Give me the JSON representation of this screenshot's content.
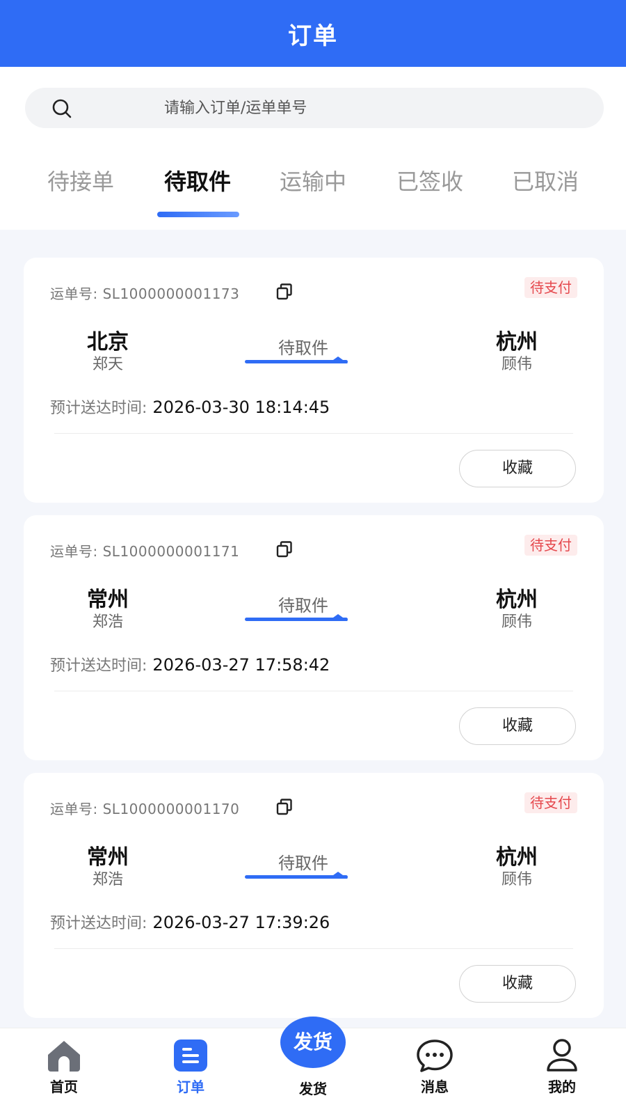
{
  "header": {
    "title": "订单"
  },
  "search": {
    "placeholder": "请输入订单/运单单号"
  },
  "tabs": [
    {
      "label": "待接单",
      "active": false
    },
    {
      "label": "待取件",
      "active": true
    },
    {
      "label": "运输中",
      "active": false
    },
    {
      "label": "已签收",
      "active": false
    },
    {
      "label": "已取消",
      "active": false
    }
  ],
  "orders": [
    {
      "waybill_label": "运单号:",
      "waybill_no": "SL1000000001173",
      "pay_status": "待支付",
      "from_city": "北京",
      "from_person": "郑天",
      "status": "待取件",
      "to_city": "杭州",
      "to_person": "顾伟",
      "eta_label": "预计送达时间:",
      "eta": "2026-03-30 18:14:45",
      "fav_label": "收藏"
    },
    {
      "waybill_label": "运单号:",
      "waybill_no": "SL1000000001171",
      "pay_status": "待支付",
      "from_city": "常州",
      "from_person": "郑浩",
      "status": "待取件",
      "to_city": "杭州",
      "to_person": "顾伟",
      "eta_label": "预计送达时间:",
      "eta": "2026-03-27 17:58:42",
      "fav_label": "收藏"
    },
    {
      "waybill_label": "运单号:",
      "waybill_no": "SL1000000001170",
      "pay_status": "待支付",
      "from_city": "常州",
      "from_person": "郑浩",
      "status": "待取件",
      "to_city": "杭州",
      "to_person": "顾伟",
      "eta_label": "预计送达时间:",
      "eta": "2026-03-27 17:39:26",
      "fav_label": "收藏"
    }
  ],
  "tabbar": {
    "home": "首页",
    "orders": "订单",
    "ship_button": "发货",
    "ship": "发货",
    "messages": "消息",
    "mine": "我的"
  },
  "colors": {
    "primary": "#2f6cf5",
    "badge_text": "#e5484d",
    "badge_bg": "#fdecec"
  },
  "icons": {
    "search": "search-icon",
    "copy": "copy-icon",
    "home": "home-icon",
    "orders": "document-list-icon",
    "messages": "chat-bubble-icon",
    "mine": "user-icon"
  }
}
